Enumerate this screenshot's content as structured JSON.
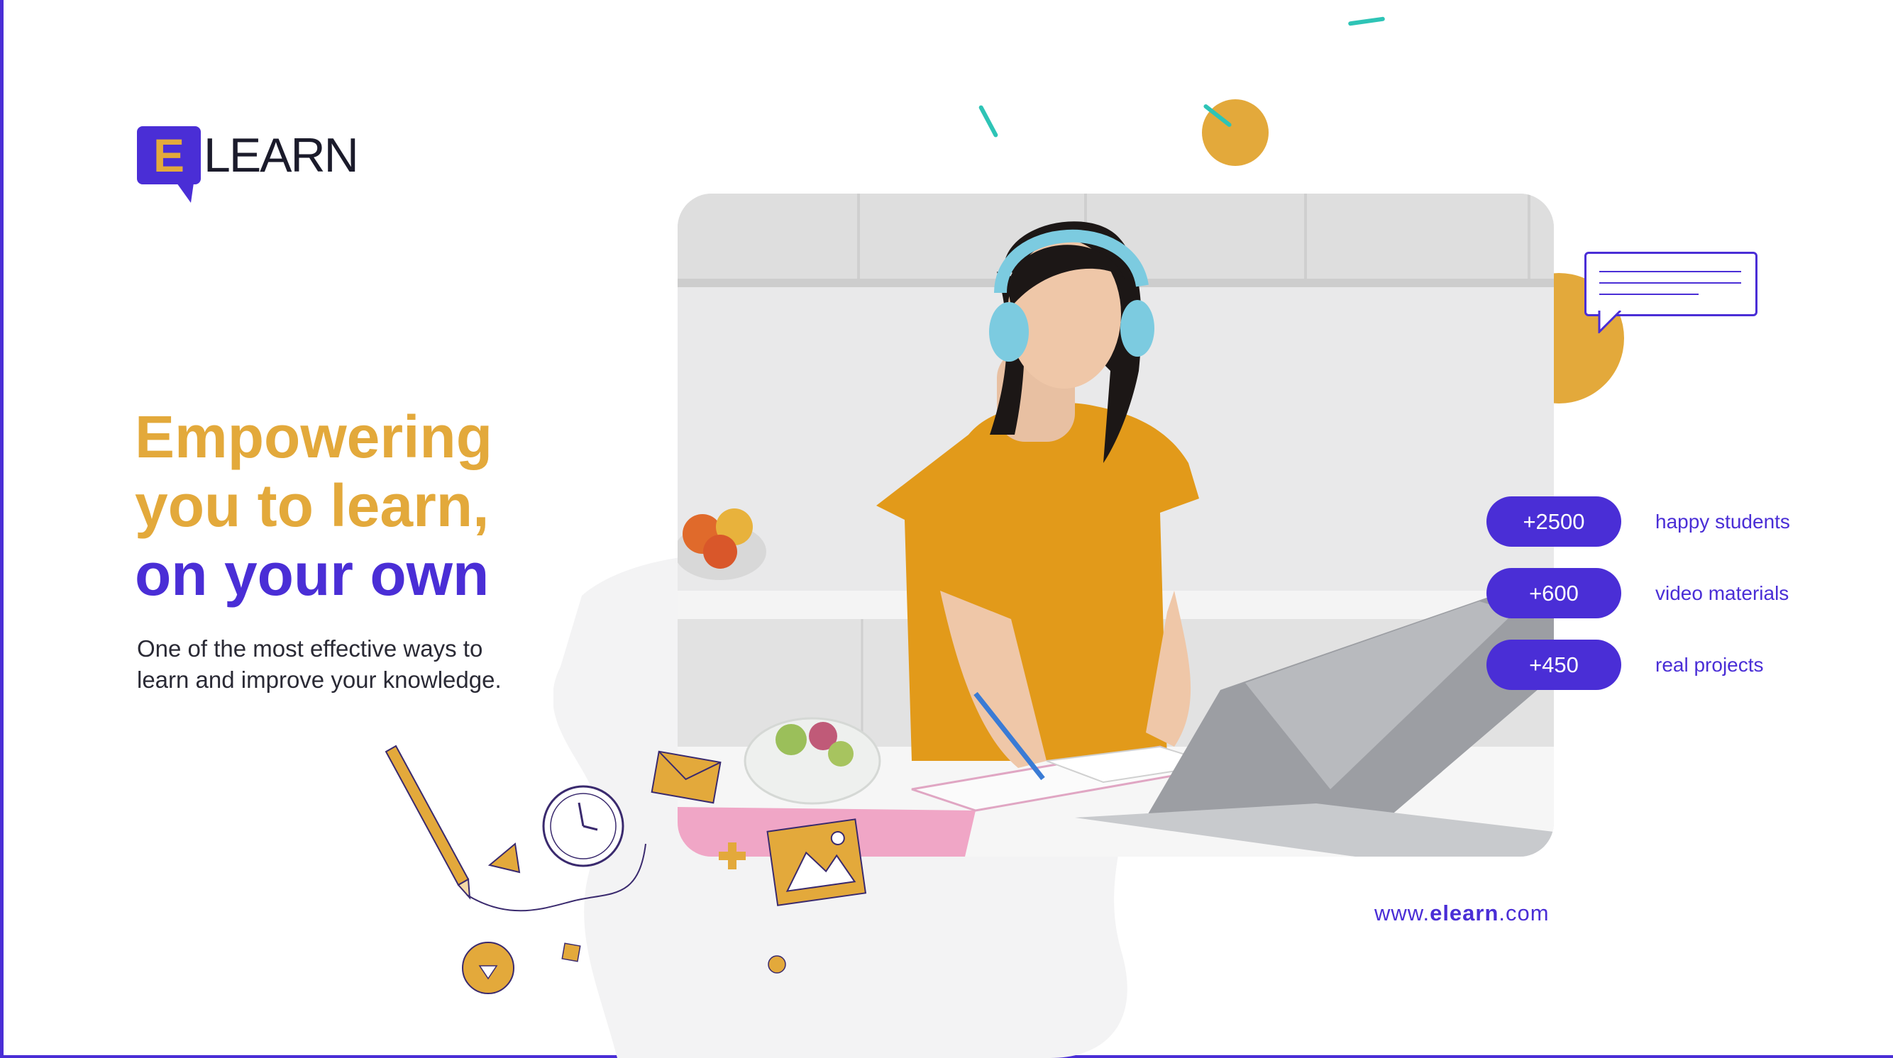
{
  "brand": {
    "logo_letter": "E",
    "logo_word": "LEARN",
    "colors": {
      "primary": "#4a2ed6",
      "accent": "#e3a93b",
      "teal": "#2ec4b6"
    }
  },
  "hero": {
    "headline_line1": "Empowering",
    "headline_line2": "you to learn,",
    "headline_line3": "on your own",
    "subtext_line1": "One of the most effective ways to",
    "subtext_line2": "learn and improve your knowledge."
  },
  "stats": [
    {
      "value": "+2500",
      "label": "happy students"
    },
    {
      "value": "+600",
      "label": "video materials"
    },
    {
      "value": "+450",
      "label": "real projects"
    }
  ],
  "footer": {
    "url_prefix": "www.",
    "url_brand": "elearn",
    "url_suffix": ".com"
  },
  "icons": [
    "pencil-icon",
    "clock-icon",
    "envelope-icon",
    "image-icon",
    "play-icon",
    "chat-bubble-icon"
  ]
}
